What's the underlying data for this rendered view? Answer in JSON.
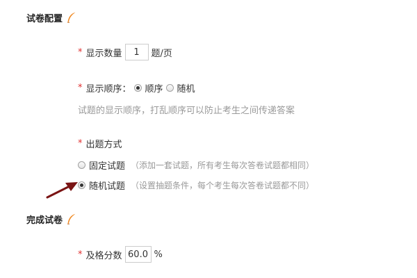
{
  "section_exam_config": {
    "title": "试卷配置",
    "icon": "feather-icon"
  },
  "display_count": {
    "label": "显示数量",
    "value": "1",
    "unit": "题/页"
  },
  "display_order": {
    "label": "显示顺序：",
    "options": [
      {
        "label": "顺序",
        "checked": true
      },
      {
        "label": "随机",
        "checked": false
      }
    ],
    "hint": "试题的显示顺序，打乱顺序可以防止考生之间传递答案"
  },
  "question_mode": {
    "label": "出题方式",
    "options": [
      {
        "label": "固定试题",
        "desc": "（添加一套试题，所有考生每次答卷试题都相同）",
        "checked": false
      },
      {
        "label": "随机试题",
        "desc": "（设置抽题条件，每个考生每次答卷试题都不同）",
        "checked": true
      }
    ]
  },
  "section_finish": {
    "title": "完成试卷",
    "icon": "feather-icon"
  },
  "pass_score": {
    "label": "及格分数",
    "value": "60.0",
    "unit": "%"
  },
  "required_mark": "*",
  "colors": {
    "required": "#e03030",
    "hint": "#999999",
    "feather": "#f08a24",
    "arrow": "#7a1414"
  }
}
